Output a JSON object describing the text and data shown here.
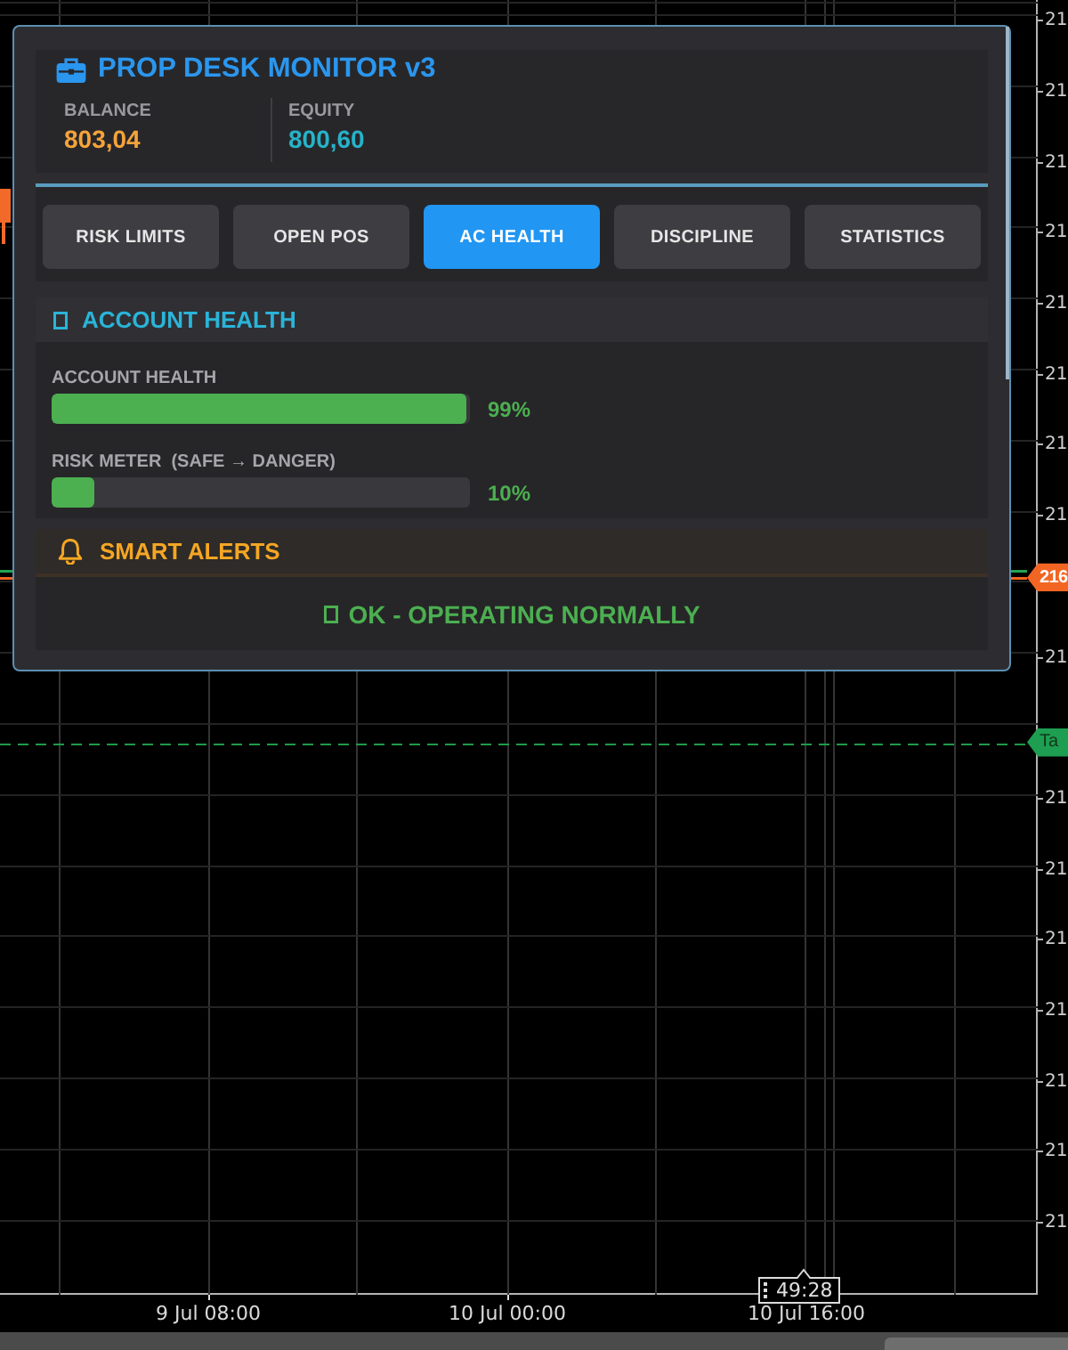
{
  "panel": {
    "title": "PROP DESK MONITOR v3",
    "stats": [
      {
        "label": "BALANCE",
        "value": "803,04",
        "color": "#f5a33a"
      },
      {
        "label": "EQUITY",
        "value": "800,60",
        "color": "#26b3c9"
      }
    ],
    "tabs": [
      {
        "label": "RISK LIMITS",
        "selected": false
      },
      {
        "label": "OPEN POS",
        "selected": false
      },
      {
        "label": "AC HEALTH",
        "selected": true
      },
      {
        "label": "DISCIPLINE",
        "selected": false
      },
      {
        "label": "STATISTICS",
        "selected": false
      }
    ],
    "health_section": {
      "title": "ACCOUNT HEALTH",
      "meters": [
        {
          "label": "ACCOUNT HEALTH",
          "level": 0.99,
          "reading": "99%"
        },
        {
          "label": "RISK METER  (SAFE → DANGER)",
          "level": 0.1,
          "reading": "10%"
        }
      ]
    },
    "alerts_section": {
      "title": "SMART ALERTS",
      "message": "OK - OPERATING NORMALLY"
    }
  },
  "chart": {
    "price_axis": [
      {
        "kind": "tick",
        "text": "21"
      },
      {
        "kind": "tick",
        "text": "21"
      },
      {
        "kind": "tick",
        "text": "21"
      },
      {
        "kind": "tick",
        "text": "21"
      },
      {
        "kind": "tick",
        "text": "21"
      },
      {
        "kind": "tick",
        "text": "21"
      },
      {
        "kind": "tick",
        "text": "21"
      },
      {
        "kind": "tick",
        "text": "21"
      },
      {
        "kind": "price",
        "text": "216",
        "color": "#f26522"
      },
      {
        "kind": "tick",
        "text": "21"
      },
      {
        "kind": "target",
        "text": "Ta",
        "color": "#1e9e50"
      },
      {
        "kind": "tick",
        "text": "21"
      },
      {
        "kind": "tick",
        "text": "21"
      },
      {
        "kind": "tick",
        "text": "21"
      },
      {
        "kind": "tick",
        "text": "21"
      },
      {
        "kind": "tick",
        "text": "21"
      },
      {
        "kind": "tick",
        "text": "21"
      },
      {
        "kind": "tick",
        "text": "21"
      }
    ],
    "time_axis": [
      "9 Jul 08:00",
      "10 Jul 00:00",
      "10 Jul 16:00"
    ],
    "countdown": "49:28"
  }
}
